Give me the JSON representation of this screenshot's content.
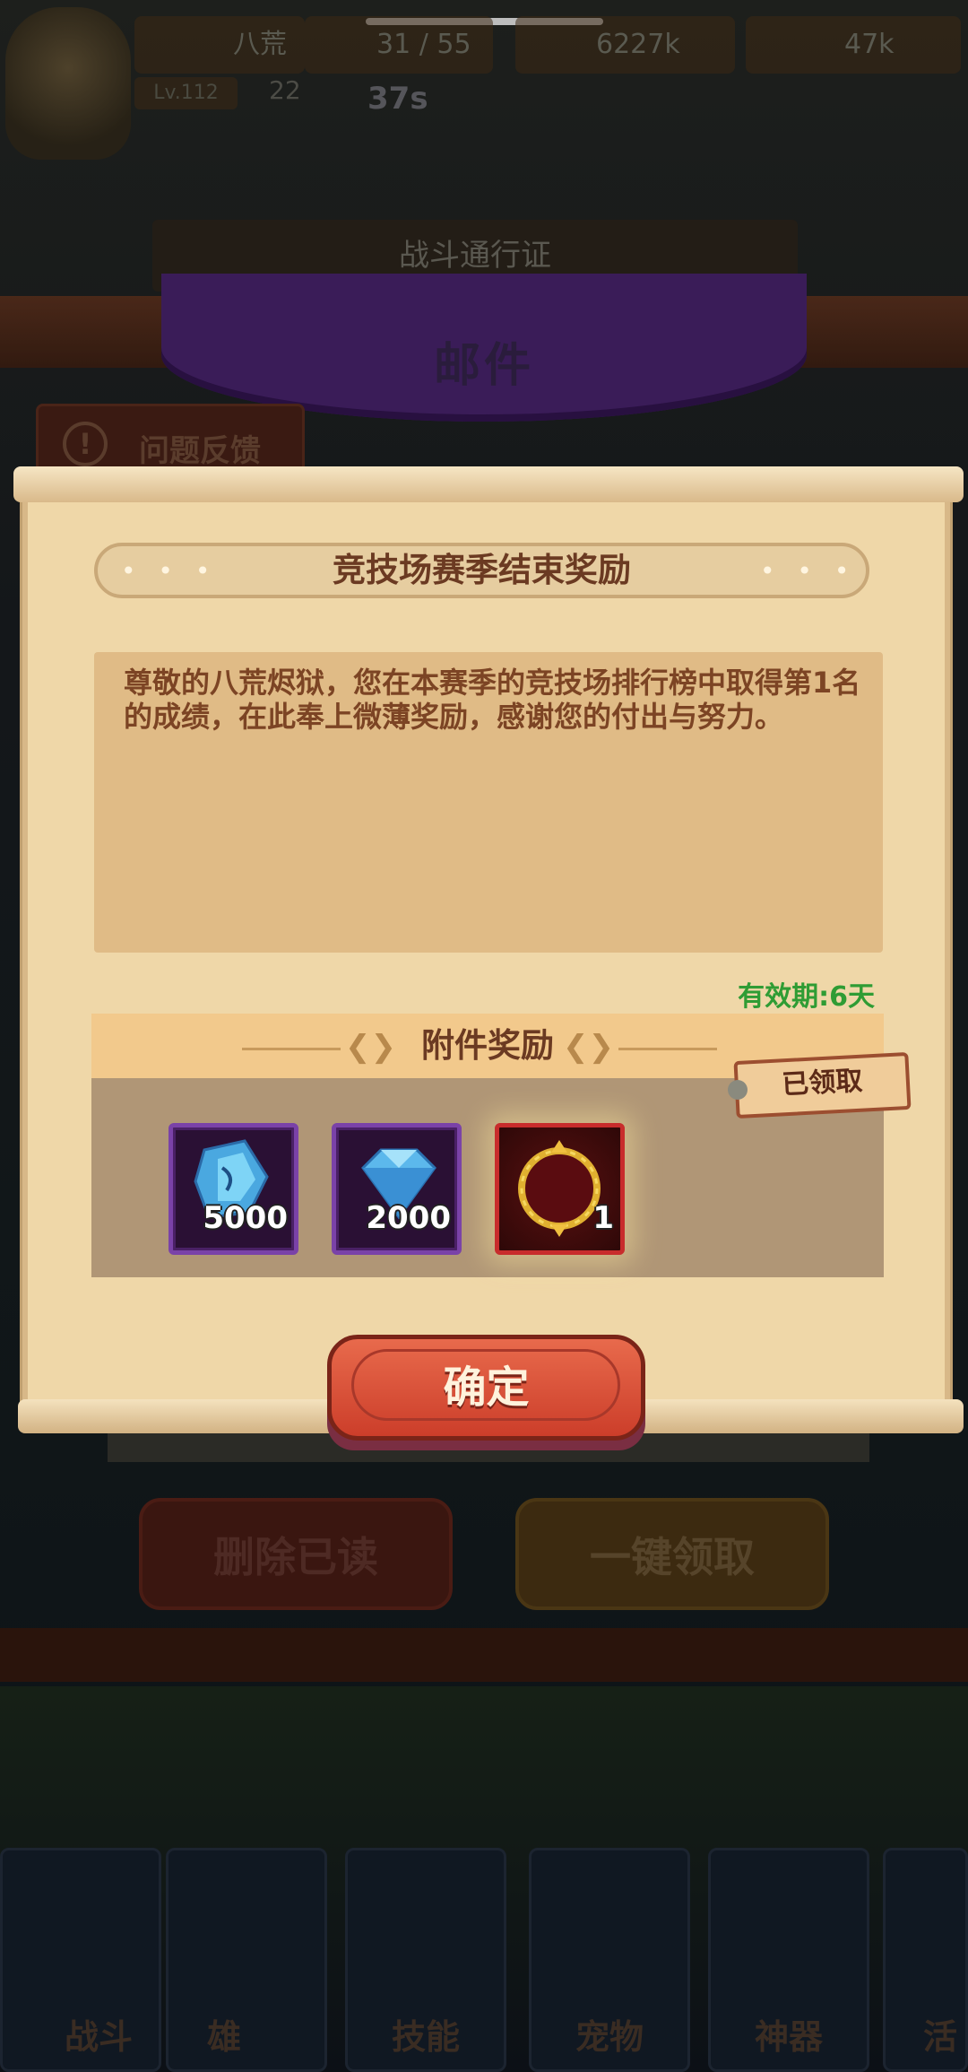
{
  "status": {
    "player_name": "八荒",
    "level": "Lv.112",
    "stamina": "31 / 55",
    "gold": "6227k",
    "gems": "47k",
    "power": "22",
    "timer": "37s"
  },
  "background": {
    "pass_label": "战斗通行证",
    "screen_title": "邮件",
    "feedback_label": "问题反馈",
    "feedback_icon": "!",
    "delete_read_label": "删除已读",
    "claim_all_label": "一键领取",
    "tabs": [
      "战斗",
      "英雄",
      "技能",
      "宠物",
      "神器",
      "活动"
    ],
    "tab_labels_visible": [
      "战斗",
      "雄",
      "技能",
      "宠物",
      "神器",
      "活"
    ]
  },
  "mail": {
    "title": "竞技场赛季结束奖励",
    "title_dots": "• • •",
    "body": "尊敬的八荒烬狱，您在本赛季的竞技场排行榜中取得第1名的成绩，在此奉上微薄奖励，感谢您的付出与努力。",
    "expiry": "有效期:6天",
    "attachments_title": "附件奖励",
    "claimed_label": "已领取",
    "items": [
      {
        "icon": "blue-crystal-icon",
        "count": "5000",
        "frame": "purple"
      },
      {
        "icon": "blue-diamond-icon",
        "count": "2000",
        "frame": "purple"
      },
      {
        "icon": "golden-ring-icon",
        "count": "1",
        "frame": "red"
      }
    ],
    "confirm_label": "确定"
  }
}
